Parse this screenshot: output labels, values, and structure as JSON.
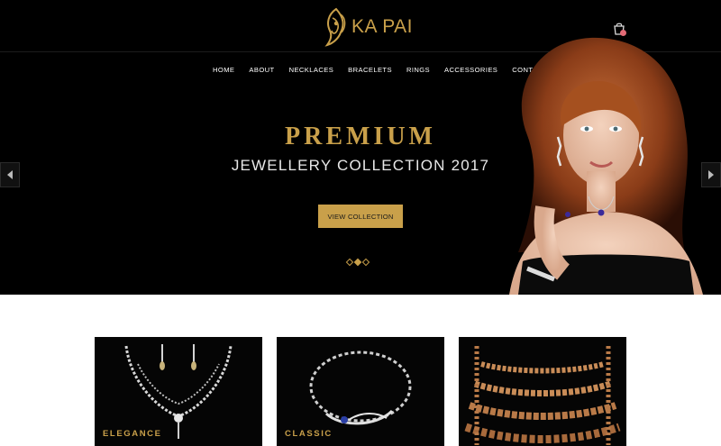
{
  "brand": {
    "name": "KA PAI",
    "accent": "#c9a04a"
  },
  "nav": [
    "HOME",
    "ABOUT",
    "NECKLACES",
    "BRACELETS",
    "RINGS",
    "ACCESSORIES",
    "CONTACT US"
  ],
  "hero": {
    "title": "PREMIUM",
    "subtitle": "JEWELLERY COLLECTION 2017",
    "cta": "VIEW COLLECTION",
    "slides": 3,
    "active_slide": 2
  },
  "icons": {
    "cart": "shopping-bag-icon",
    "prev": "chevron-left-icon",
    "next": "chevron-right-icon"
  },
  "categories": [
    {
      "label": "ELEGANCE"
    },
    {
      "label": "CLASSIC"
    },
    {
      "label": ""
    }
  ]
}
